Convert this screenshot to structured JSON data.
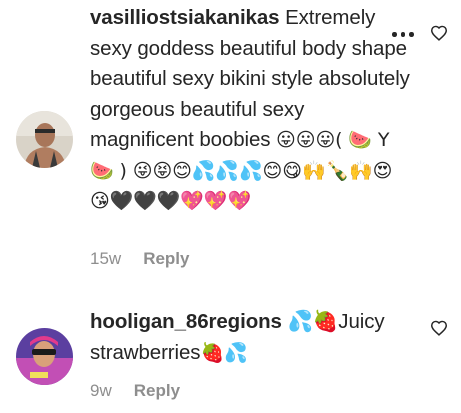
{
  "comments": [
    {
      "username": "vasilliostsiakanikas",
      "text": " Extremely sexy goddess beautiful body shape beautiful sexy bikini style absolutely gorgeous beautiful sexy magnificent boobies ",
      "emojis": "😛😛😛( 🍉 Y 🍉 ) 😜😝😊💦💦💦😊😋🙌🍾🙌😍😘🖤🖤🖤💖💖💖",
      "time": "15w",
      "reply_label": "Reply",
      "avatar_icon": "person-avatar-icon",
      "has_more_menu": true
    },
    {
      "username": "hooligan_86regions",
      "text_before": " 💦🍓Juicy strawberries",
      "emojis": "🍓💦",
      "time": "9w",
      "reply_label": "Reply",
      "avatar_icon": "person-avatar-icon",
      "has_more_menu": false
    }
  ],
  "colors": {
    "text": "#262626",
    "meta": "#8e8e8e",
    "background": "#ffffff"
  },
  "icons": {
    "more": "more-horizontal-icon",
    "like": "heart-outline-icon"
  }
}
